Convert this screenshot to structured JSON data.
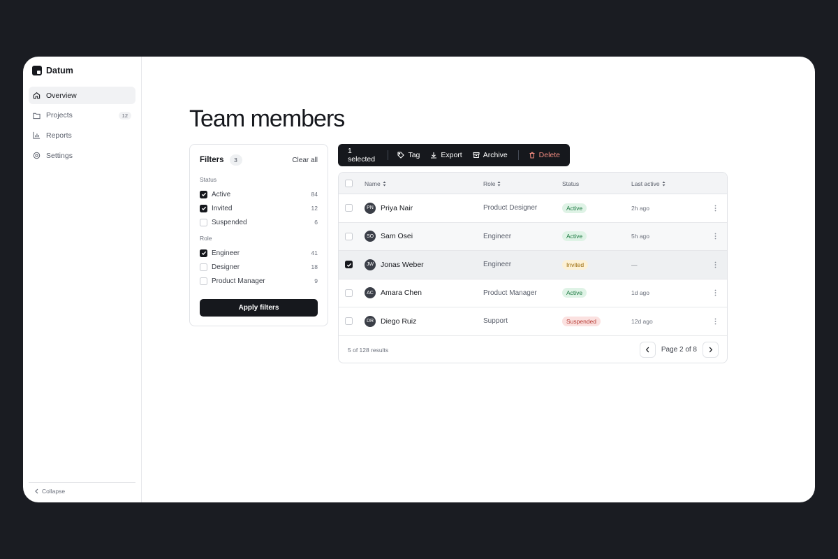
{
  "app": {
    "name": "Datum"
  },
  "sidebar": {
    "items": [
      {
        "label": "Overview",
        "icon": "home-icon",
        "active": true
      },
      {
        "label": "Projects",
        "icon": "folder-icon",
        "badge": "12"
      },
      {
        "label": "Reports",
        "icon": "bar-chart-icon"
      },
      {
        "label": "Settings",
        "icon": "gear-icon"
      }
    ],
    "collapse_label": "Collapse"
  },
  "page": {
    "title": "Team members"
  },
  "filters": {
    "title": "Filters",
    "count": "3",
    "clear_label": "Clear all",
    "groups": [
      {
        "label": "Status",
        "options": [
          {
            "label": "Active",
            "count": "84",
            "checked": true
          },
          {
            "label": "Invited",
            "count": "12",
            "checked": true
          },
          {
            "label": "Suspended",
            "count": "6",
            "checked": false
          }
        ]
      },
      {
        "label": "Role",
        "options": [
          {
            "label": "Engineer",
            "count": "41",
            "checked": true
          },
          {
            "label": "Designer",
            "count": "18",
            "checked": false
          },
          {
            "label": "Product Manager",
            "count": "9",
            "checked": false
          }
        ]
      }
    ],
    "apply_label": "Apply filters"
  },
  "bulk": {
    "selected_label": "1 selected",
    "tag_label": "Tag",
    "export_label": "Export",
    "archive_label": "Archive",
    "delete_label": "Delete"
  },
  "table": {
    "headers": {
      "name": "Name",
      "role": "Role",
      "status": "Status",
      "last_active": "Last active"
    },
    "rows": [
      {
        "initials": "PN",
        "name": "Priya Nair",
        "role": "Product Designer",
        "status": "Active",
        "status_kind": "active",
        "last_active": "2h ago",
        "checked": false
      },
      {
        "initials": "SO",
        "name": "Sam Osei",
        "role": "Engineer",
        "status": "Active",
        "status_kind": "active",
        "last_active": "5h ago",
        "checked": false
      },
      {
        "initials": "JW",
        "name": "Jonas Weber",
        "role": "Engineer",
        "status": "Invited",
        "status_kind": "invited",
        "last_active": "—",
        "checked": true
      },
      {
        "initials": "AC",
        "name": "Amara Chen",
        "role": "Product Manager",
        "status": "Active",
        "status_kind": "active",
        "last_active": "1d ago",
        "checked": false
      },
      {
        "initials": "DR",
        "name": "Diego Ruiz",
        "role": "Support",
        "status": "Suspended",
        "status_kind": "suspended",
        "last_active": "12d ago",
        "checked": false
      }
    ],
    "results_label": "5 of 128 results",
    "page_label": "Page 2 of 8"
  },
  "colors": {
    "accent": "#16181d",
    "backdrop": "#1a1c22",
    "active_badge": "#dff3e6",
    "invited_badge": "#fcf1d6",
    "suspended_badge": "#fbe1e0",
    "delete_text": "#f28b80"
  }
}
